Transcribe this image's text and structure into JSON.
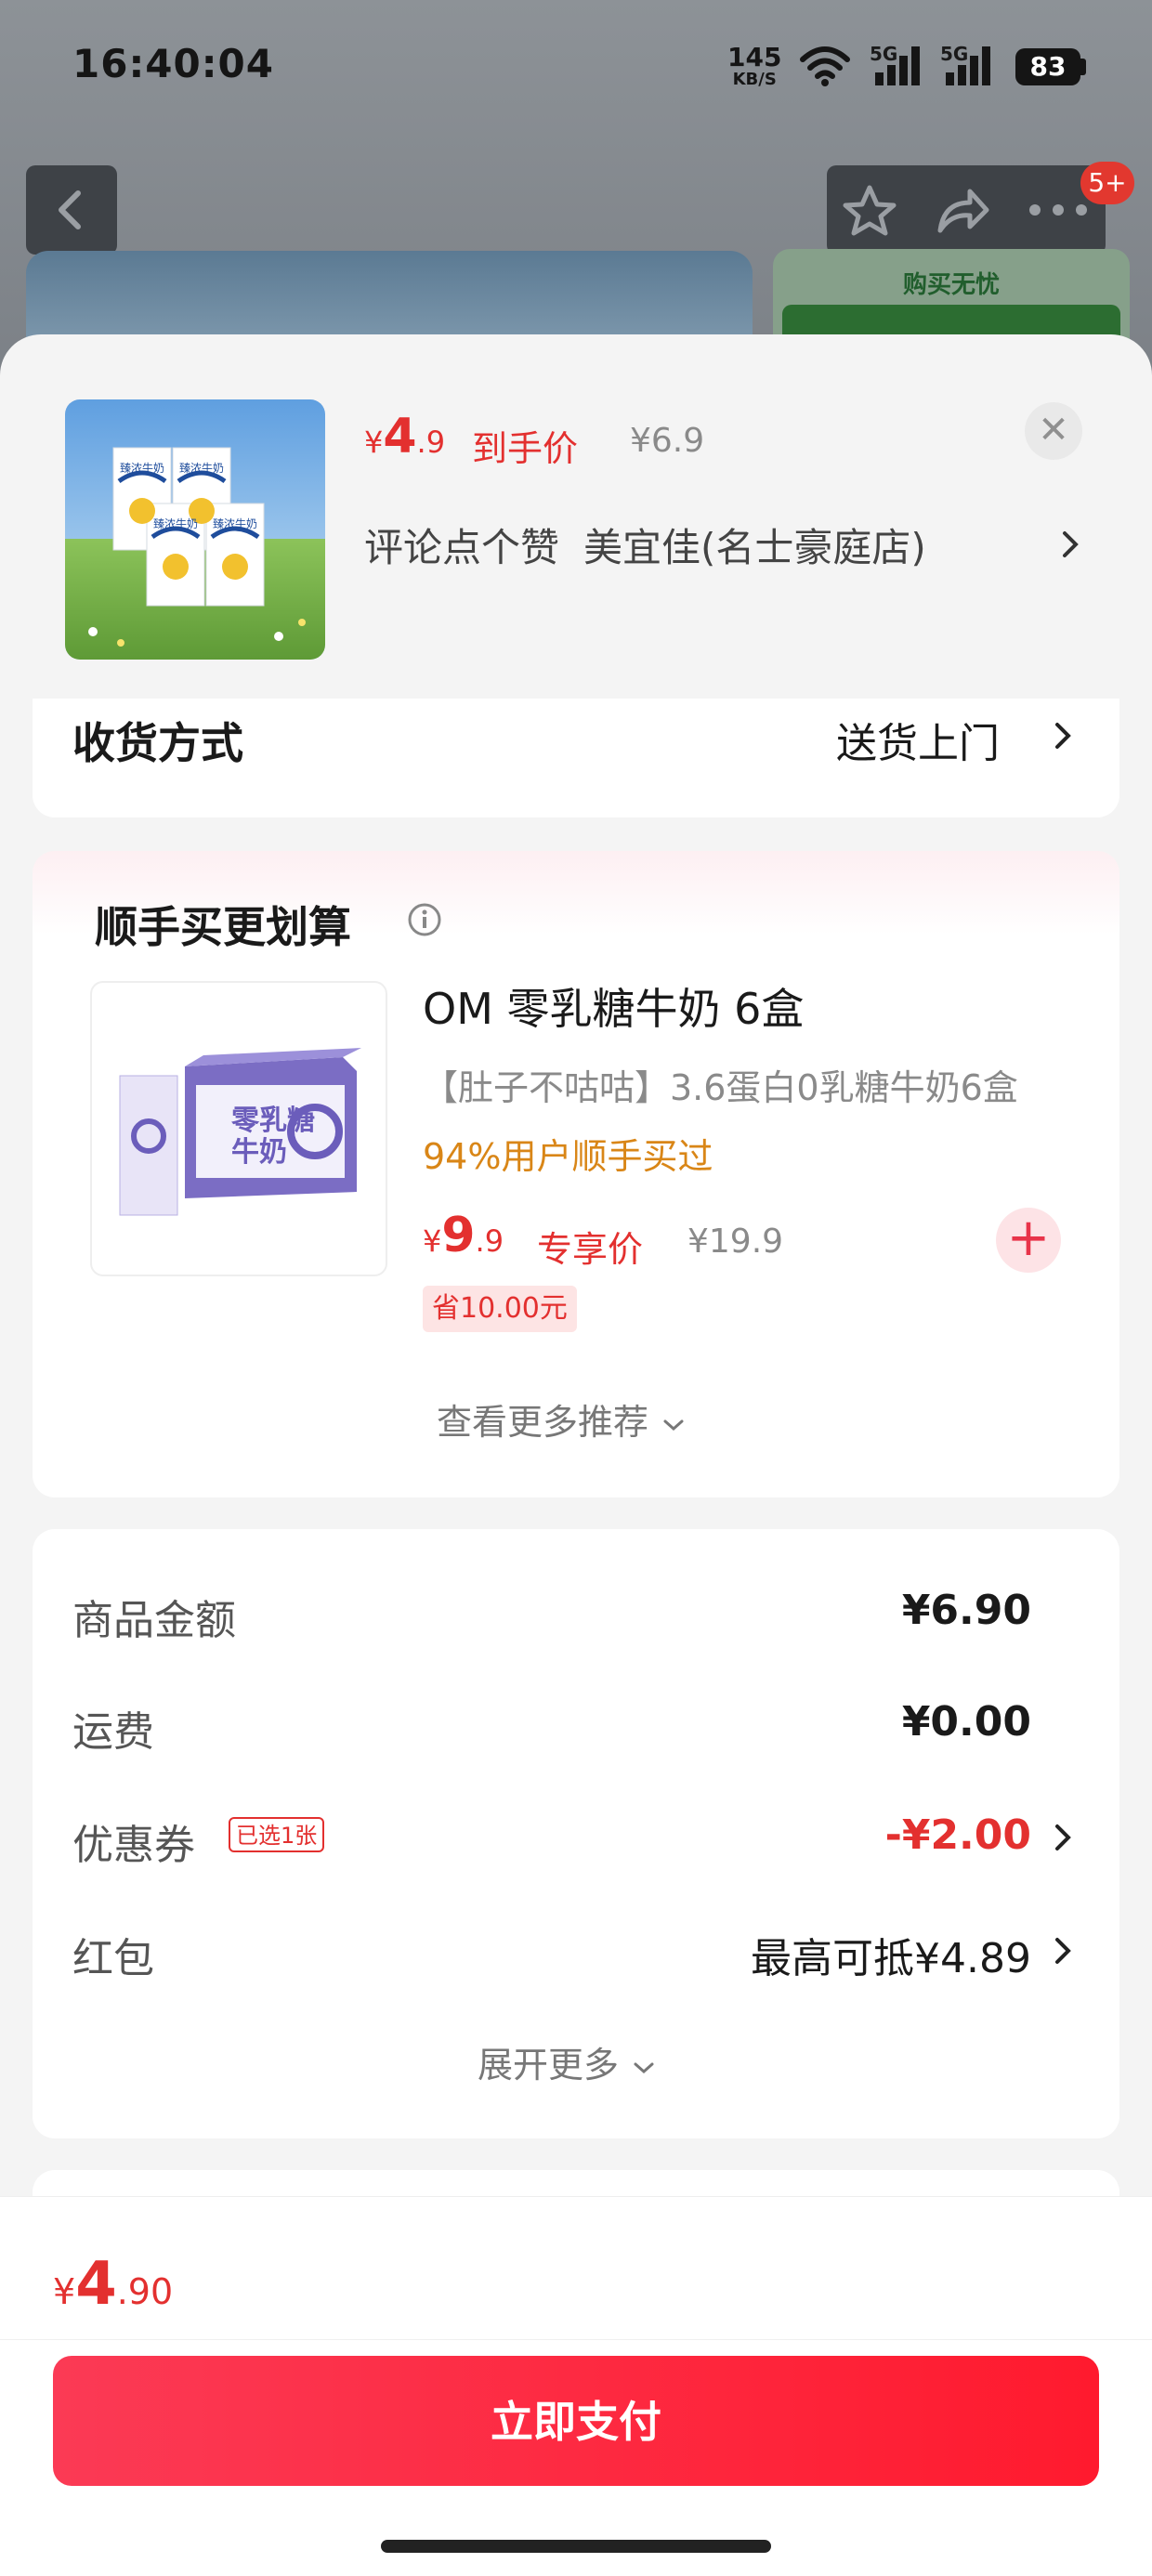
{
  "status_bar": {
    "time": "16:40:04",
    "net_speed": "145",
    "net_unit": "KB/S",
    "sig1": "5G",
    "sig2": "5G",
    "battery": "83"
  },
  "bg_page": {
    "notification_badge": "5+",
    "side_panel_title": "购买无忧"
  },
  "product": {
    "price_currency": "¥",
    "price_int": "4",
    "price_dec": ".9",
    "price_tag": "到手价",
    "original_price": "¥6.9",
    "promo_text": "评论点个赞",
    "store_name": "美宜佳(名士豪庭店)",
    "close_icon": "close-icon"
  },
  "delivery": {
    "label": "收货方式",
    "value": "送货上门"
  },
  "addon": {
    "title": "顺手买更划算",
    "info_icon": "info-icon",
    "item": {
      "name": "OM 零乳糖牛奶 6盒",
      "desc": "【肚子不咕咕】3.6蛋白0乳糖牛奶6盒",
      "social": "94%用户顺手买过",
      "price_currency": "¥",
      "price_int": "9",
      "price_dec": ".9",
      "price_tag": "专享价",
      "original_price": "¥19.9",
      "save": "省10.00元",
      "pack_brand": "零乳糖",
      "pack_sub": "牛奶"
    },
    "more": "查看更多推荐"
  },
  "summary": {
    "rows": [
      {
        "label": "商品金额",
        "value": "¥6.90"
      },
      {
        "label": "运费",
        "value": "¥0.00"
      },
      {
        "label": "优惠券",
        "tag": "已选1张",
        "value": "-¥2.00"
      },
      {
        "label": "红包",
        "value": "最高可抵¥4.89"
      }
    ],
    "expand": "展开更多"
  },
  "footer": {
    "currency": "¥",
    "total_int": "4",
    "total_dec": ".90",
    "pay_label": "立即支付"
  },
  "colors": {
    "accent": "#e3302f",
    "pay_start": "#fb3a55",
    "pay_end": "#ff1a2e",
    "orange": "#d98617"
  },
  "thumb_labels": {
    "carton": "臻浓牛奶"
  }
}
